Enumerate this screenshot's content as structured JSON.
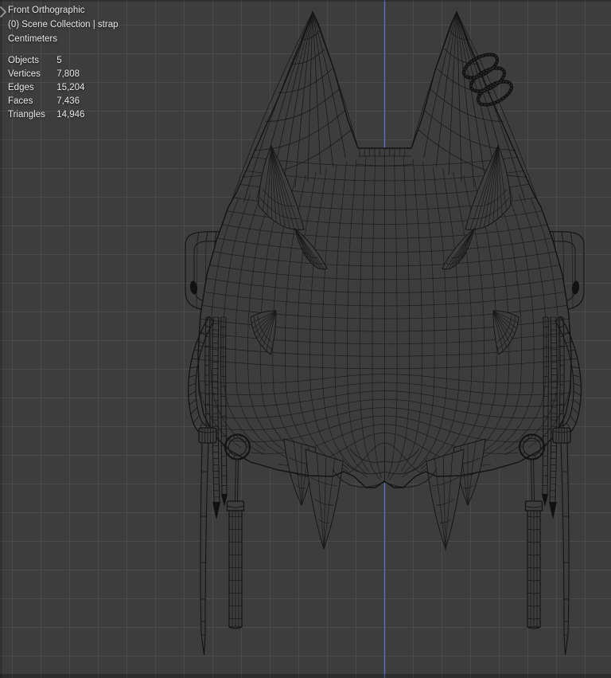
{
  "viewport": {
    "view_label": "Front Orthographic",
    "context_label": "(0) Scene Collection | strap",
    "units_label": "Centimeters",
    "stats": [
      {
        "label": "Objects",
        "value": "5"
      },
      {
        "label": "Vertices",
        "value": "7,808"
      },
      {
        "label": "Edges",
        "value": "15,204"
      },
      {
        "label": "Faces",
        "value": "7,436"
      },
      {
        "label": "Triangles",
        "value": "14,946"
      }
    ],
    "icons": {
      "sidebar_toggle": "chevron-right-icon"
    },
    "colors": {
      "background": "#3d3d3d",
      "grid": "#4a4a4a",
      "axis_z": "#5077b5",
      "wire": "#1e1e1e",
      "wire_dark": "#141414",
      "text": "#e6e6e6"
    }
  }
}
